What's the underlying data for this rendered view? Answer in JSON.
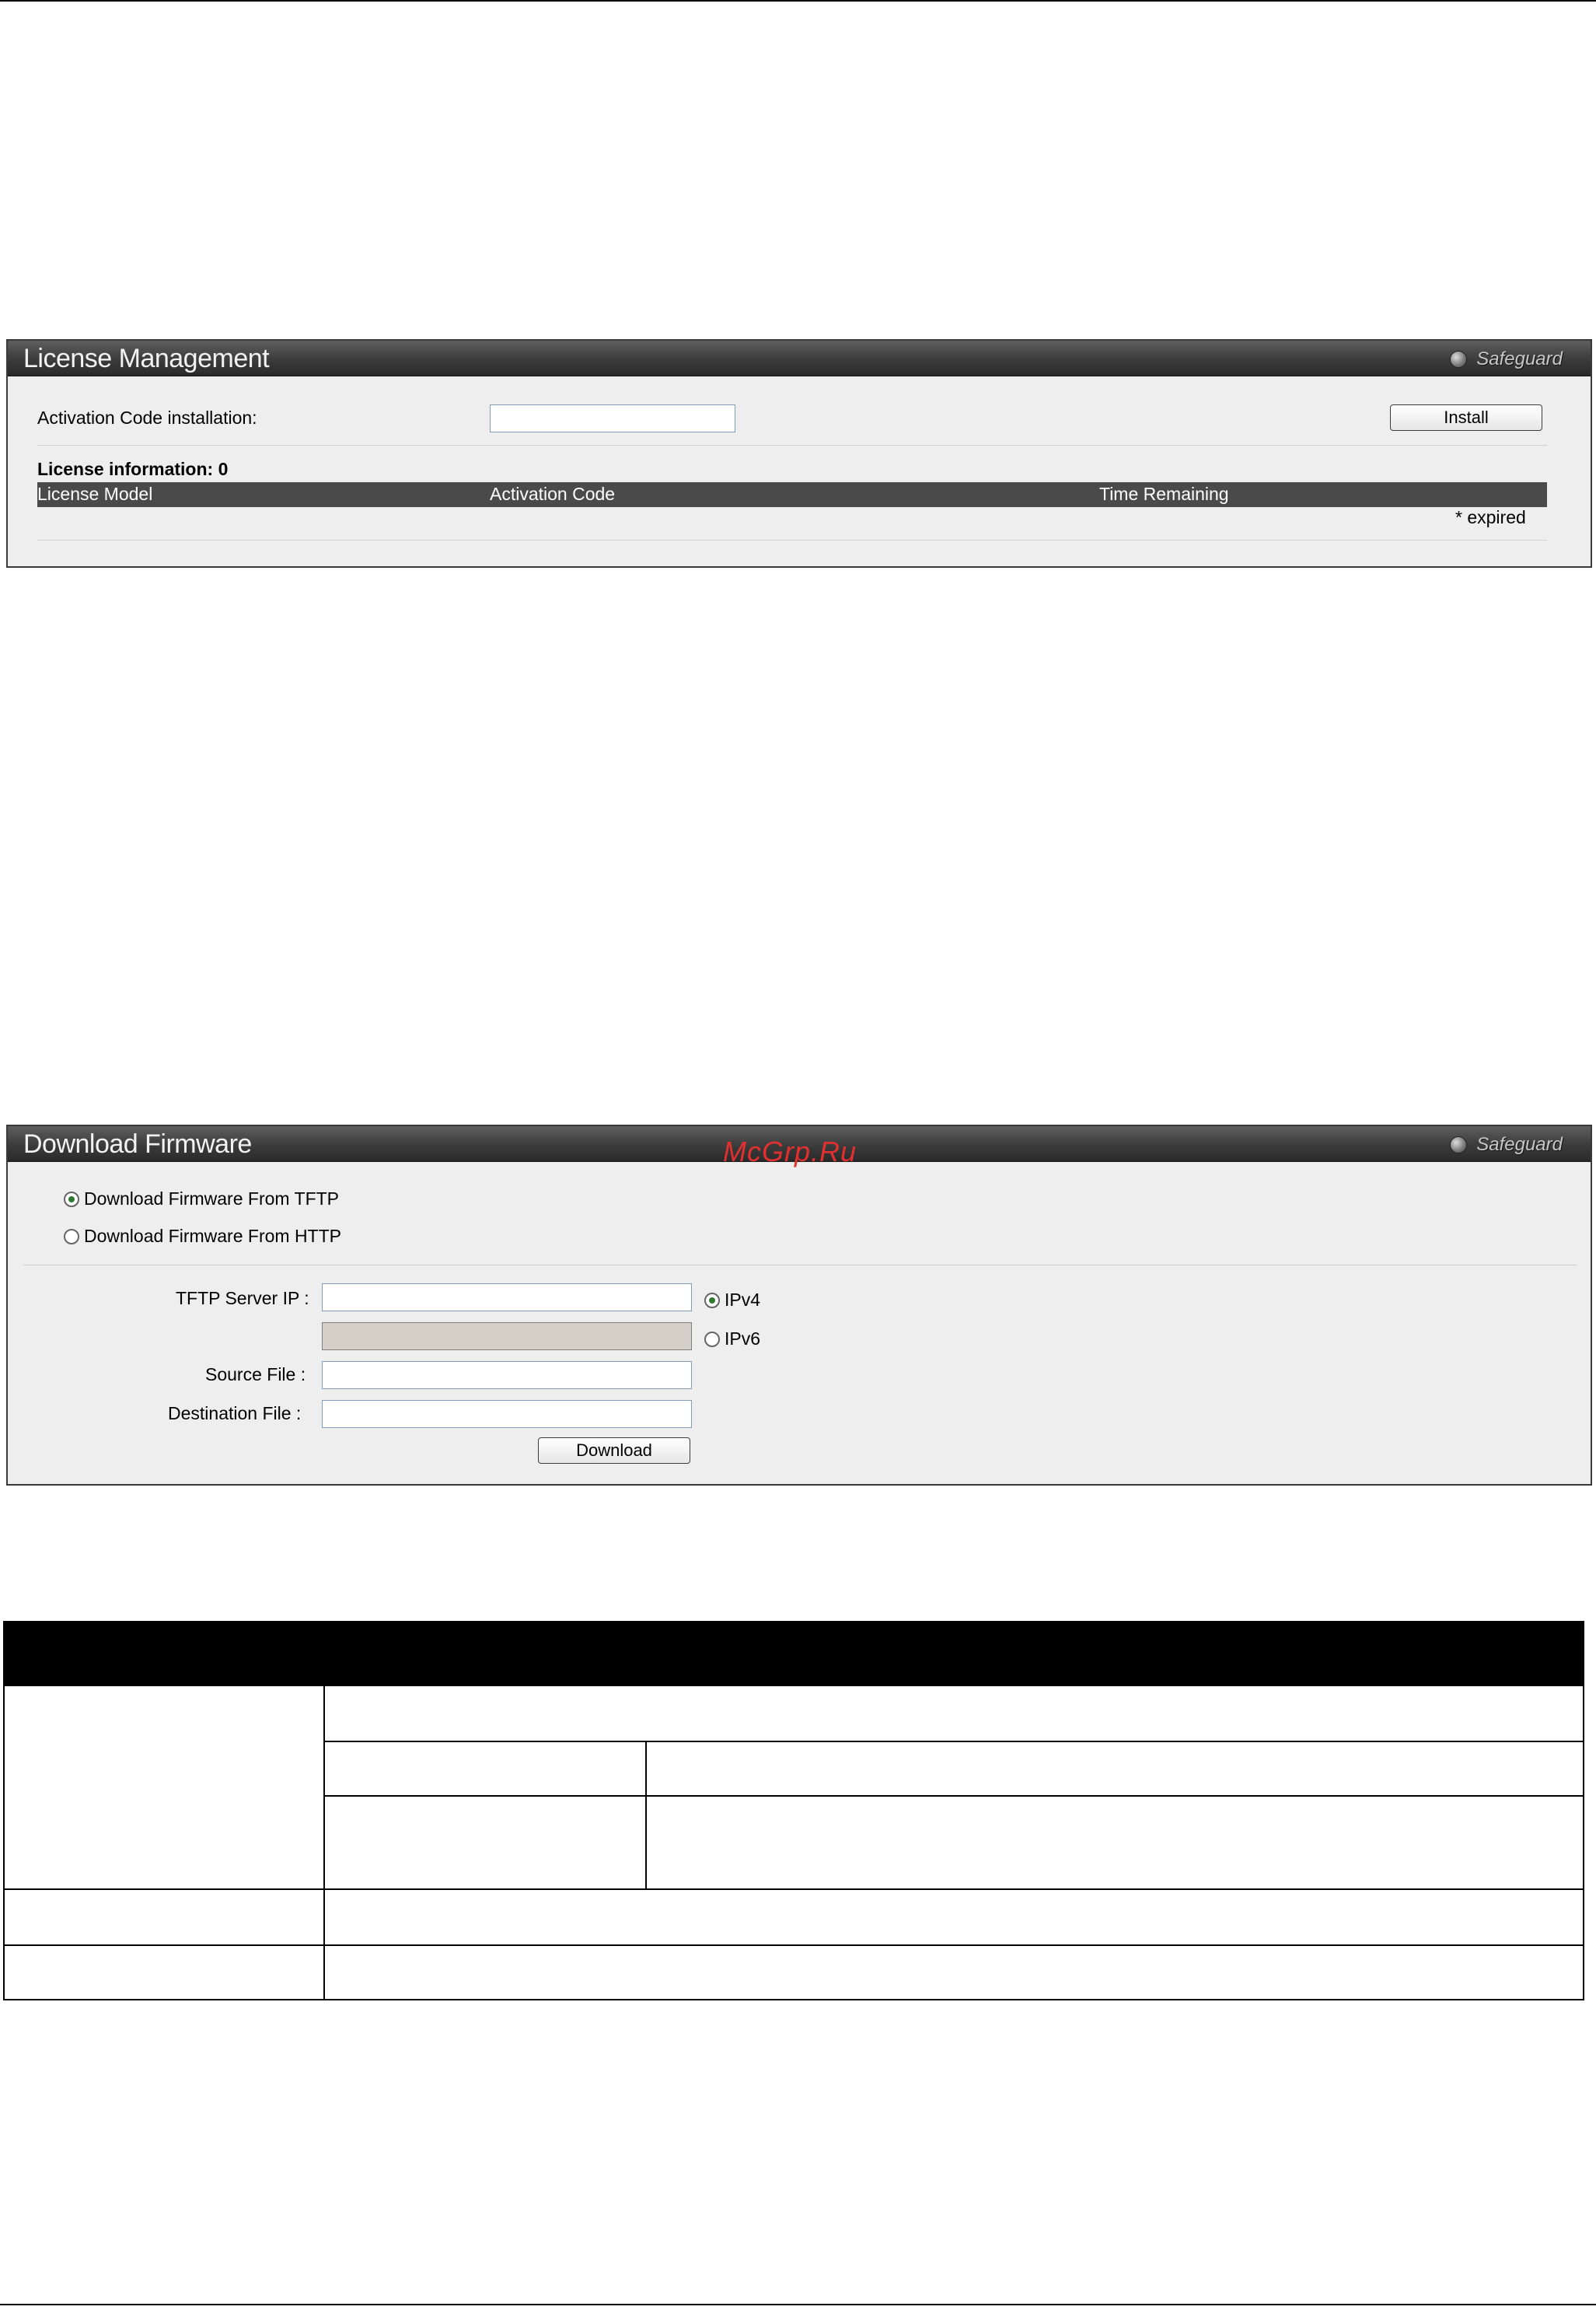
{
  "license_panel": {
    "title": "License Management",
    "safeguard": "Safeguard",
    "activation_label": "Activation Code installation:",
    "activation_value": "",
    "install_button": "Install",
    "info_label": "License information: 0",
    "columns": [
      "License Model",
      "Activation Code",
      "Time Remaining"
    ],
    "footnote": "* expired"
  },
  "firmware_panel": {
    "title": "Download Firmware",
    "safeguard": "Safeguard",
    "source_options": [
      {
        "label": "Download Firmware From TFTP",
        "checked": true
      },
      {
        "label": "Download Firmware From HTTP",
        "checked": false
      }
    ],
    "tftp_label": "TFTP Server IP :",
    "tftp_value": "",
    "ipv6_value": "",
    "ip_options": [
      {
        "label": "IPv4",
        "checked": true
      },
      {
        "label": "IPv6",
        "checked": false
      }
    ],
    "source_file_label": "Source File :",
    "source_file_value": "",
    "destination_file_label": "Destination File :",
    "destination_file_value": "",
    "download_button": "Download"
  },
  "watermark": "McGrp.Ru"
}
